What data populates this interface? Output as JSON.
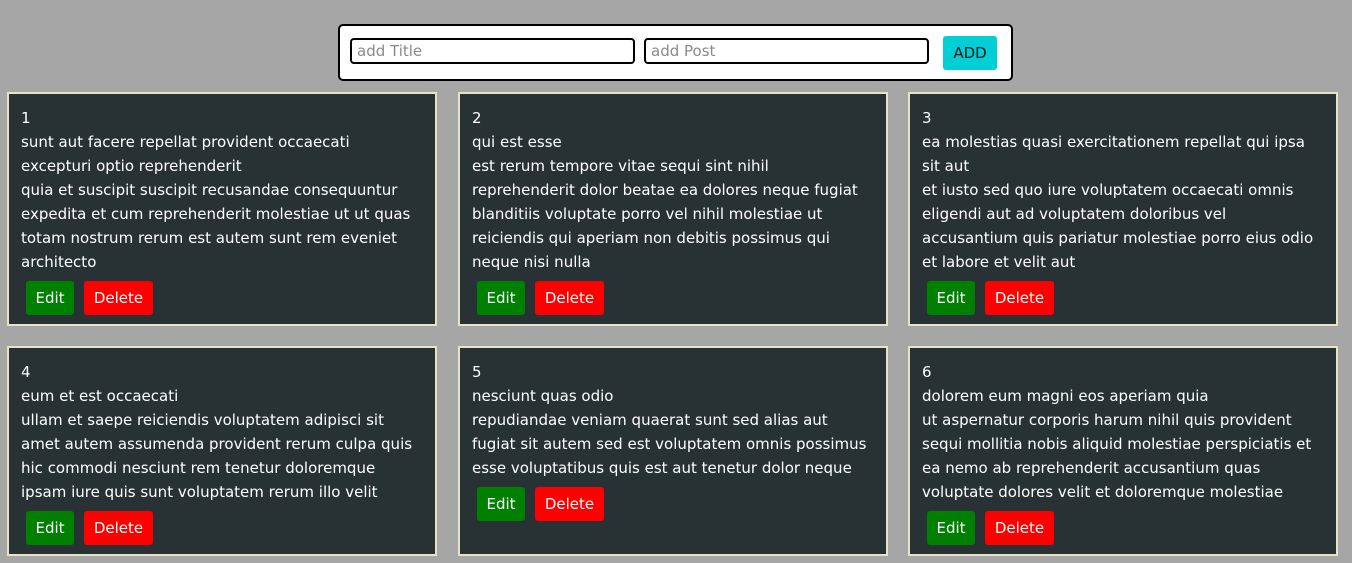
{
  "form": {
    "title_placeholder": "add Title",
    "post_placeholder": "add Post",
    "add_label": "ADD"
  },
  "posts": [
    {
      "id": "1",
      "title": "sunt aut facere repellat provident occaecati excepturi optio reprehenderit",
      "body": "quia et suscipit suscipit recusandae consequuntur expedita et cum reprehenderit molestiae ut ut quas totam nostrum rerum est autem sunt rem eveniet architecto",
      "edit_label": "Edit",
      "delete_label": "Delete"
    },
    {
      "id": "2",
      "title": "qui est esse",
      "body": "est rerum tempore vitae sequi sint nihil reprehenderit dolor beatae ea dolores neque fugiat blanditiis voluptate porro vel nihil molestiae ut reiciendis qui aperiam non debitis possimus qui neque nisi nulla",
      "edit_label": "Edit",
      "delete_label": "Delete"
    },
    {
      "id": "3",
      "title": "ea molestias quasi exercitationem repellat qui ipsa sit aut",
      "body": "et iusto sed quo iure voluptatem occaecati omnis eligendi aut ad voluptatem doloribus vel accusantium quis pariatur molestiae porro eius odio et labore et velit aut",
      "edit_label": "Edit",
      "delete_label": "Delete"
    },
    {
      "id": "4",
      "title": "eum et est occaecati",
      "body": "ullam et saepe reiciendis voluptatem adipisci sit amet autem assumenda provident rerum culpa quis hic commodi nesciunt rem tenetur doloremque ipsam iure quis sunt voluptatem rerum illo velit",
      "edit_label": "Edit",
      "delete_label": "Delete"
    },
    {
      "id": "5",
      "title": "nesciunt quas odio",
      "body": "repudiandae veniam quaerat sunt sed alias aut fugiat sit autem sed est voluptatem omnis possimus esse voluptatibus quis est aut tenetur dolor neque",
      "edit_label": "Edit",
      "delete_label": "Delete"
    },
    {
      "id": "6",
      "title": "dolorem eum magni eos aperiam quia",
      "body": "ut aspernatur corporis harum nihil quis provident sequi mollitia nobis aliquid molestiae perspiciatis et ea nemo ab reprehenderit accusantium quas voluptate dolores velit et doloremque molestiae",
      "edit_label": "Edit",
      "delete_label": "Delete"
    }
  ]
}
